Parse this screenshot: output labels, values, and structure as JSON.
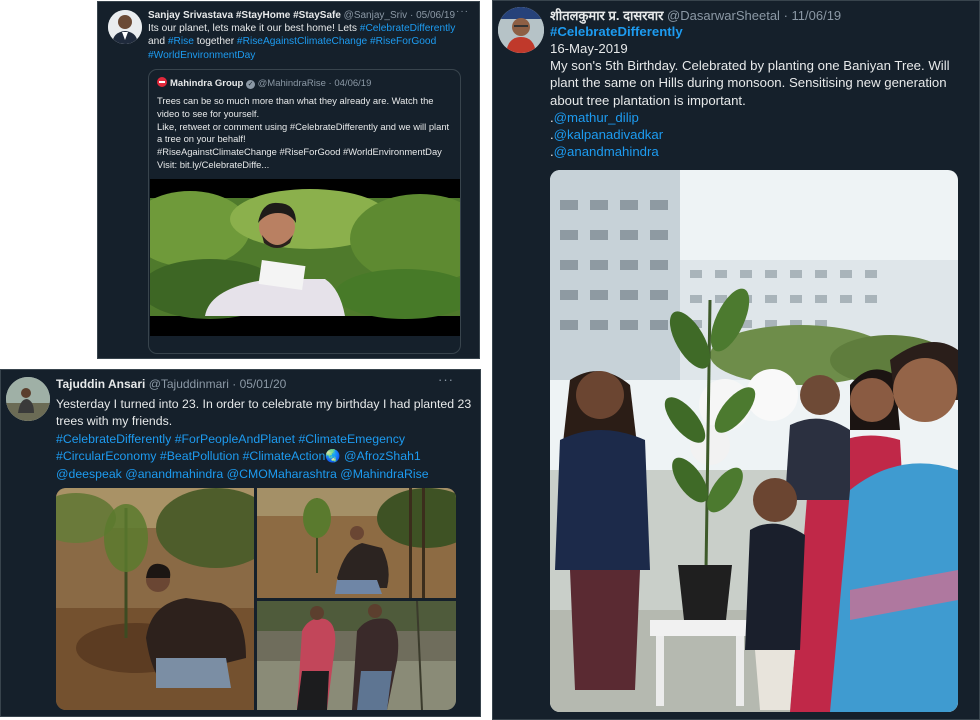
{
  "tweet1": {
    "author": "Sanjay Srivastava #StayHome #StaySafe",
    "handle": "@Sanjay_Sriv",
    "date": "05/06/19",
    "text_plain": "Its our planet, lets make it our best home! Lets ",
    "tag1": "#CelebrateDifferently",
    "text_and": "and ",
    "tag2": "#Rise",
    "text_together": " together ",
    "tag3": "#RiseAgainstClimateChange",
    "tag4": "#RiseForGood",
    "tag5": "#WorldEnvironmentDay",
    "quote": {
      "author": "Mahindra Group",
      "handle": "@MahindraRise",
      "date": "04/06/19",
      "line1": "Trees can be so much more than what they already are. Watch the video to see for yourself.",
      "line2": "Like, retweet or comment using #CelebrateDifferently and we will plant a tree on your behalf!",
      "line3": "#RiseAgainstClimateChange #RiseForGood #WorldEnvironmentDay",
      "line4": "Visit: bit.ly/CelebrateDiffe..."
    }
  },
  "tweet2": {
    "author": "Tajuddin Ansari",
    "handle": "@Tajuddinmari",
    "date": "05/01/20",
    "text": "Yesterday I turned into 23. In order to celebrate my birthday I had planted 23 trees with my friends.",
    "tags_line1": "#CelebrateDifferently #ForPeopleAndPlanet #ClimateEmegency",
    "tags_line2a": "#CircularEconomy #BeatPollution #ClimateAction",
    "globe": "🌏",
    "tags_line2b": " @AfrozShah1",
    "tags_line3": "@deespeak @anandmahindra @CMOMaharashtra @MahindraRise"
  },
  "tweet3": {
    "author": "शीतलकुमार प्र. दासरवार",
    "handle": "@DasarwarSheetal",
    "date": "11/06/19",
    "tag": "#CelebrateDifferently",
    "date_line": "16-May-2019",
    "text": "My son's 5th Birthday. Celebrated by planting one Baniyan Tree. Will plant the same on Hills during monsoon. Sensitising new generation about tree plantation is important.",
    "mention1": "@mathur_dilip",
    "mention2": "@kalpanadivadkar",
    "mention3": "@anandmahindra",
    "dot": "."
  },
  "ui": {
    "sep": " · ",
    "more": "···",
    "verified": "✓"
  },
  "colors": {
    "background": "#15202b",
    "border": "#38444d",
    "text": "#e7e9ea",
    "muted": "#8b98a5",
    "link": "#1d9bf0"
  },
  "icons": [
    "more-icon",
    "verified-icon",
    "mahindra-logo-icon"
  ]
}
